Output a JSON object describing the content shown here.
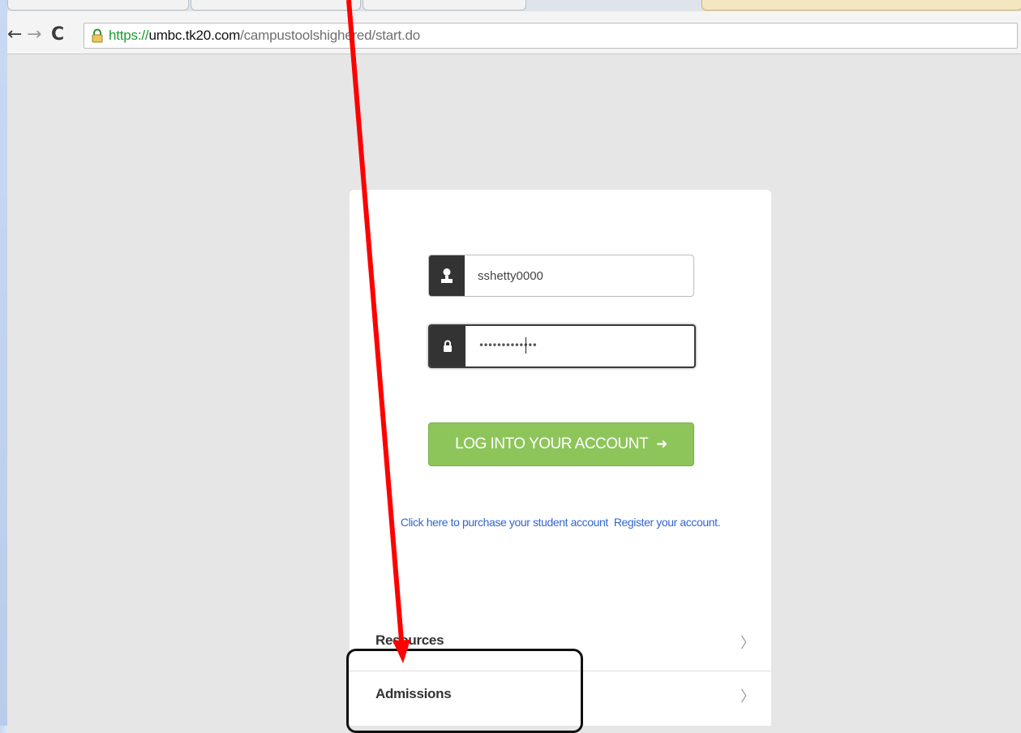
{
  "browser": {
    "nav": {
      "back_glyph": "←",
      "forward_glyph": "→",
      "reload_glyph": "C"
    },
    "address_bar": {
      "scheme": "https://",
      "host": "umbc.tk20.com",
      "path": "/campustoolshighered/start.do"
    }
  },
  "login": {
    "username_value": "sshetty0000",
    "password_masked": "•••••••••••••",
    "submit_label": "LOG INTO YOUR ACCOUNT",
    "submit_arrow": "➜",
    "purchase_link": "Click here to purchase your student account",
    "register_link": "Register your account."
  },
  "menu": {
    "resources": {
      "label": "Resources",
      "chevron": "〉"
    },
    "admissions": {
      "label": "Admissions",
      "chevron": "〉"
    }
  },
  "colors": {
    "button_green": "#8dc55a",
    "link_blue": "#3366cc",
    "annotation_red": "#ff0000",
    "https_green": "#1b9b32"
  },
  "icons": [
    "lock-icon",
    "user-icon",
    "padlock-icon",
    "chevron-right-icon",
    "annotation-arrow"
  ]
}
